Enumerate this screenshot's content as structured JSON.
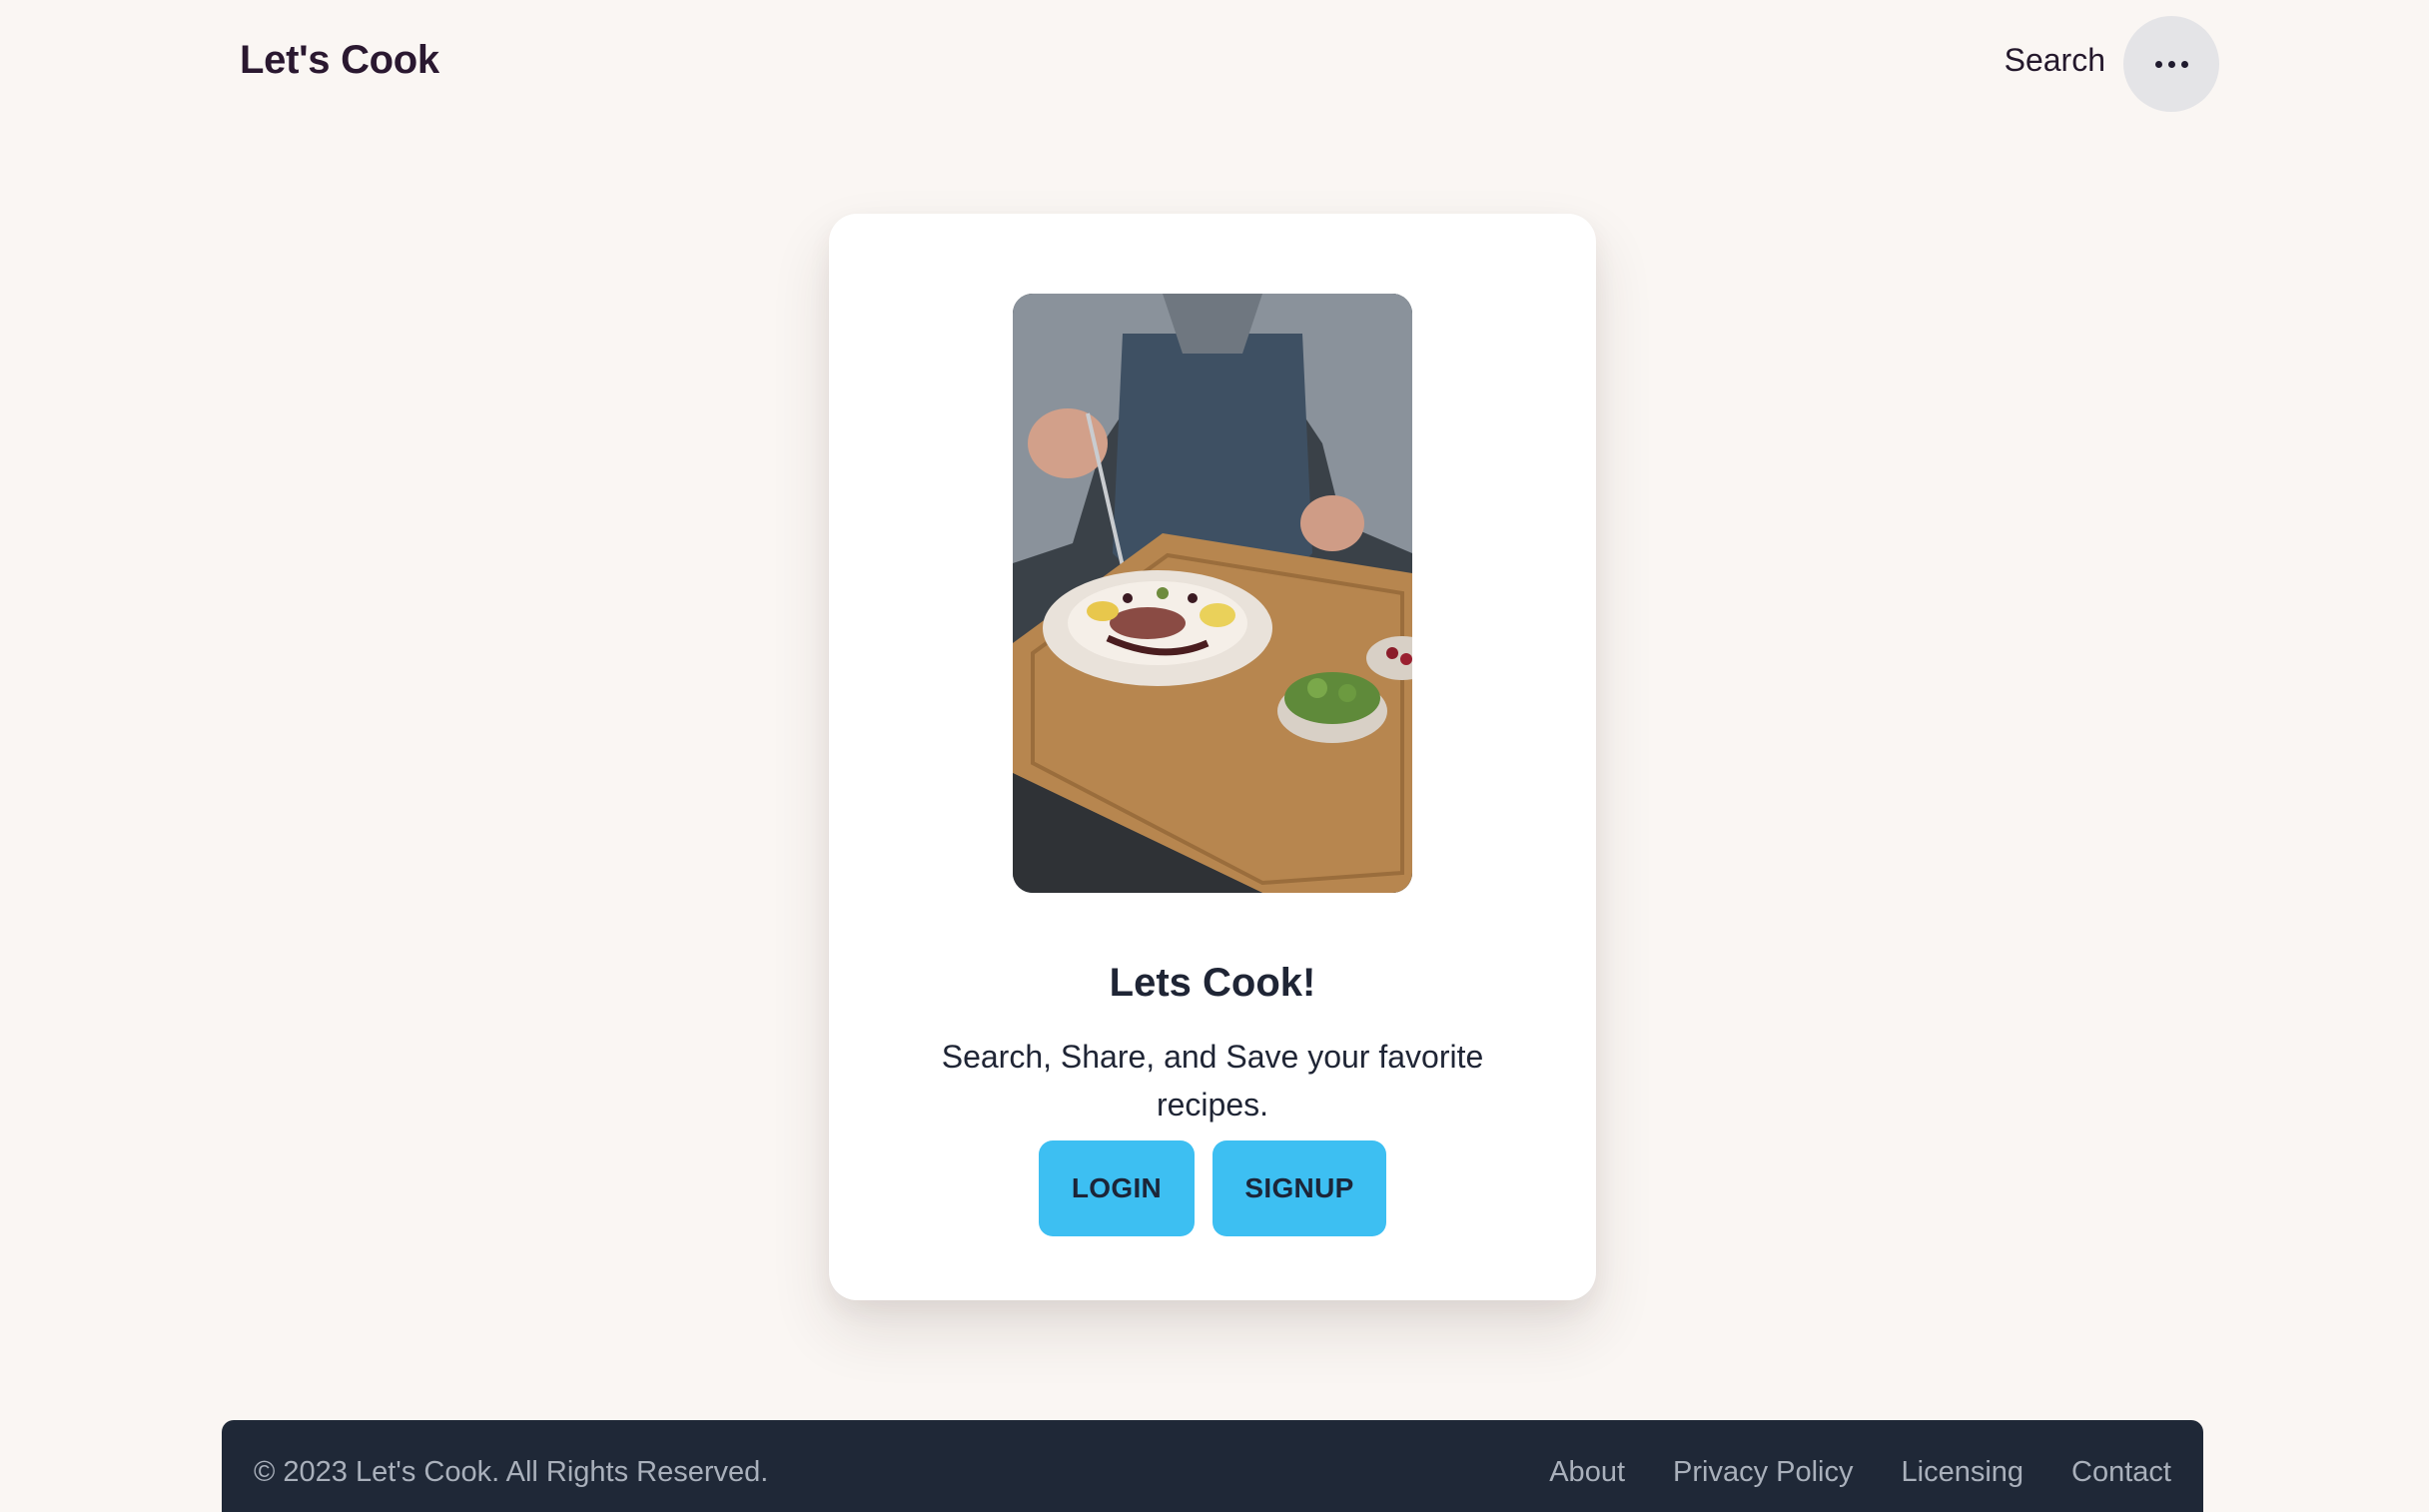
{
  "header": {
    "brand": "Let's Cook",
    "search_label": "Search",
    "menu_icon": "more-horizontal-icon"
  },
  "card": {
    "image_subject": "chef-plating-dish-photo",
    "title": "Lets Cook!",
    "subtitle": "Search, Share, and Save your favorite recipes.",
    "login_label": "LOGIN",
    "signup_label": "SIGNUP"
  },
  "footer": {
    "copyright": "© 2023 Let's Cook. All Rights Reserved.",
    "links": [
      "About",
      "Privacy Policy",
      "Licensing",
      "Contact"
    ]
  },
  "colors": {
    "background": "#faf6f3",
    "button": "#3dbff2",
    "footer": "#1f2837",
    "footer_text": "#a9b0bb"
  }
}
